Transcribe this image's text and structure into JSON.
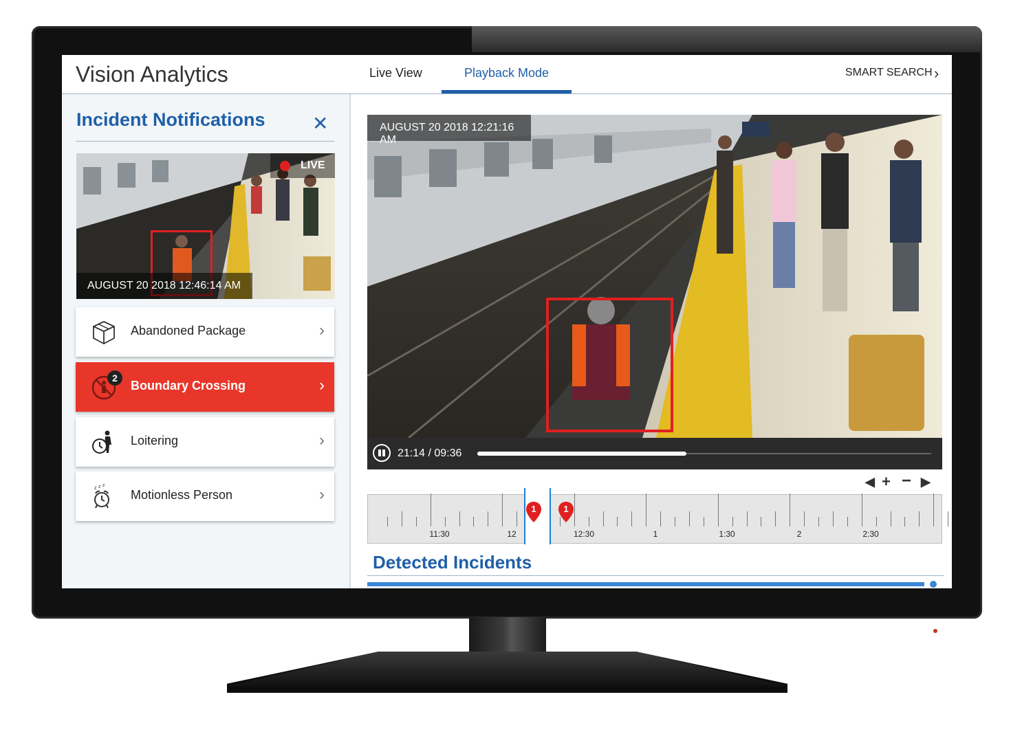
{
  "header": {
    "app_title": "Vision Analytics",
    "tabs": [
      {
        "label": "Live View",
        "active": false
      },
      {
        "label": "Playback Mode",
        "active": true
      }
    ],
    "smart_search_label": "SMART SEARCH"
  },
  "sidebar": {
    "title": "Incident Notifications",
    "live_thumbnail": {
      "live_label": "LIVE",
      "timestamp": "AUGUST 20 2018 12:46:14 AM"
    },
    "items": [
      {
        "label": "Abandoned Package",
        "icon": "package-icon",
        "active": false
      },
      {
        "label": "Boundary Crossing",
        "icon": "no-entry-icon",
        "active": true,
        "badge": "2"
      },
      {
        "label": "Loitering",
        "icon": "loitering-person-clock-icon",
        "active": false
      },
      {
        "label": "Motionless Person",
        "icon": "sleeping-alarm-clock-icon",
        "active": false
      }
    ]
  },
  "player": {
    "timestamp": "AUGUST 20 2018 12:21:16 AM",
    "time_display": "21:14 / 09:36",
    "progress": 0.46
  },
  "timeline": {
    "tick_labels": [
      "11:30",
      "12",
      "12:30",
      "1",
      "1:30",
      "2",
      "2:30"
    ],
    "markers": [
      {
        "label": "1"
      },
      {
        "label": "1"
      }
    ]
  },
  "detected_incidents": {
    "title": "Detected Incidents"
  },
  "colors": {
    "accent_blue": "#1f5fa8",
    "alert_red": "#e8372a"
  }
}
